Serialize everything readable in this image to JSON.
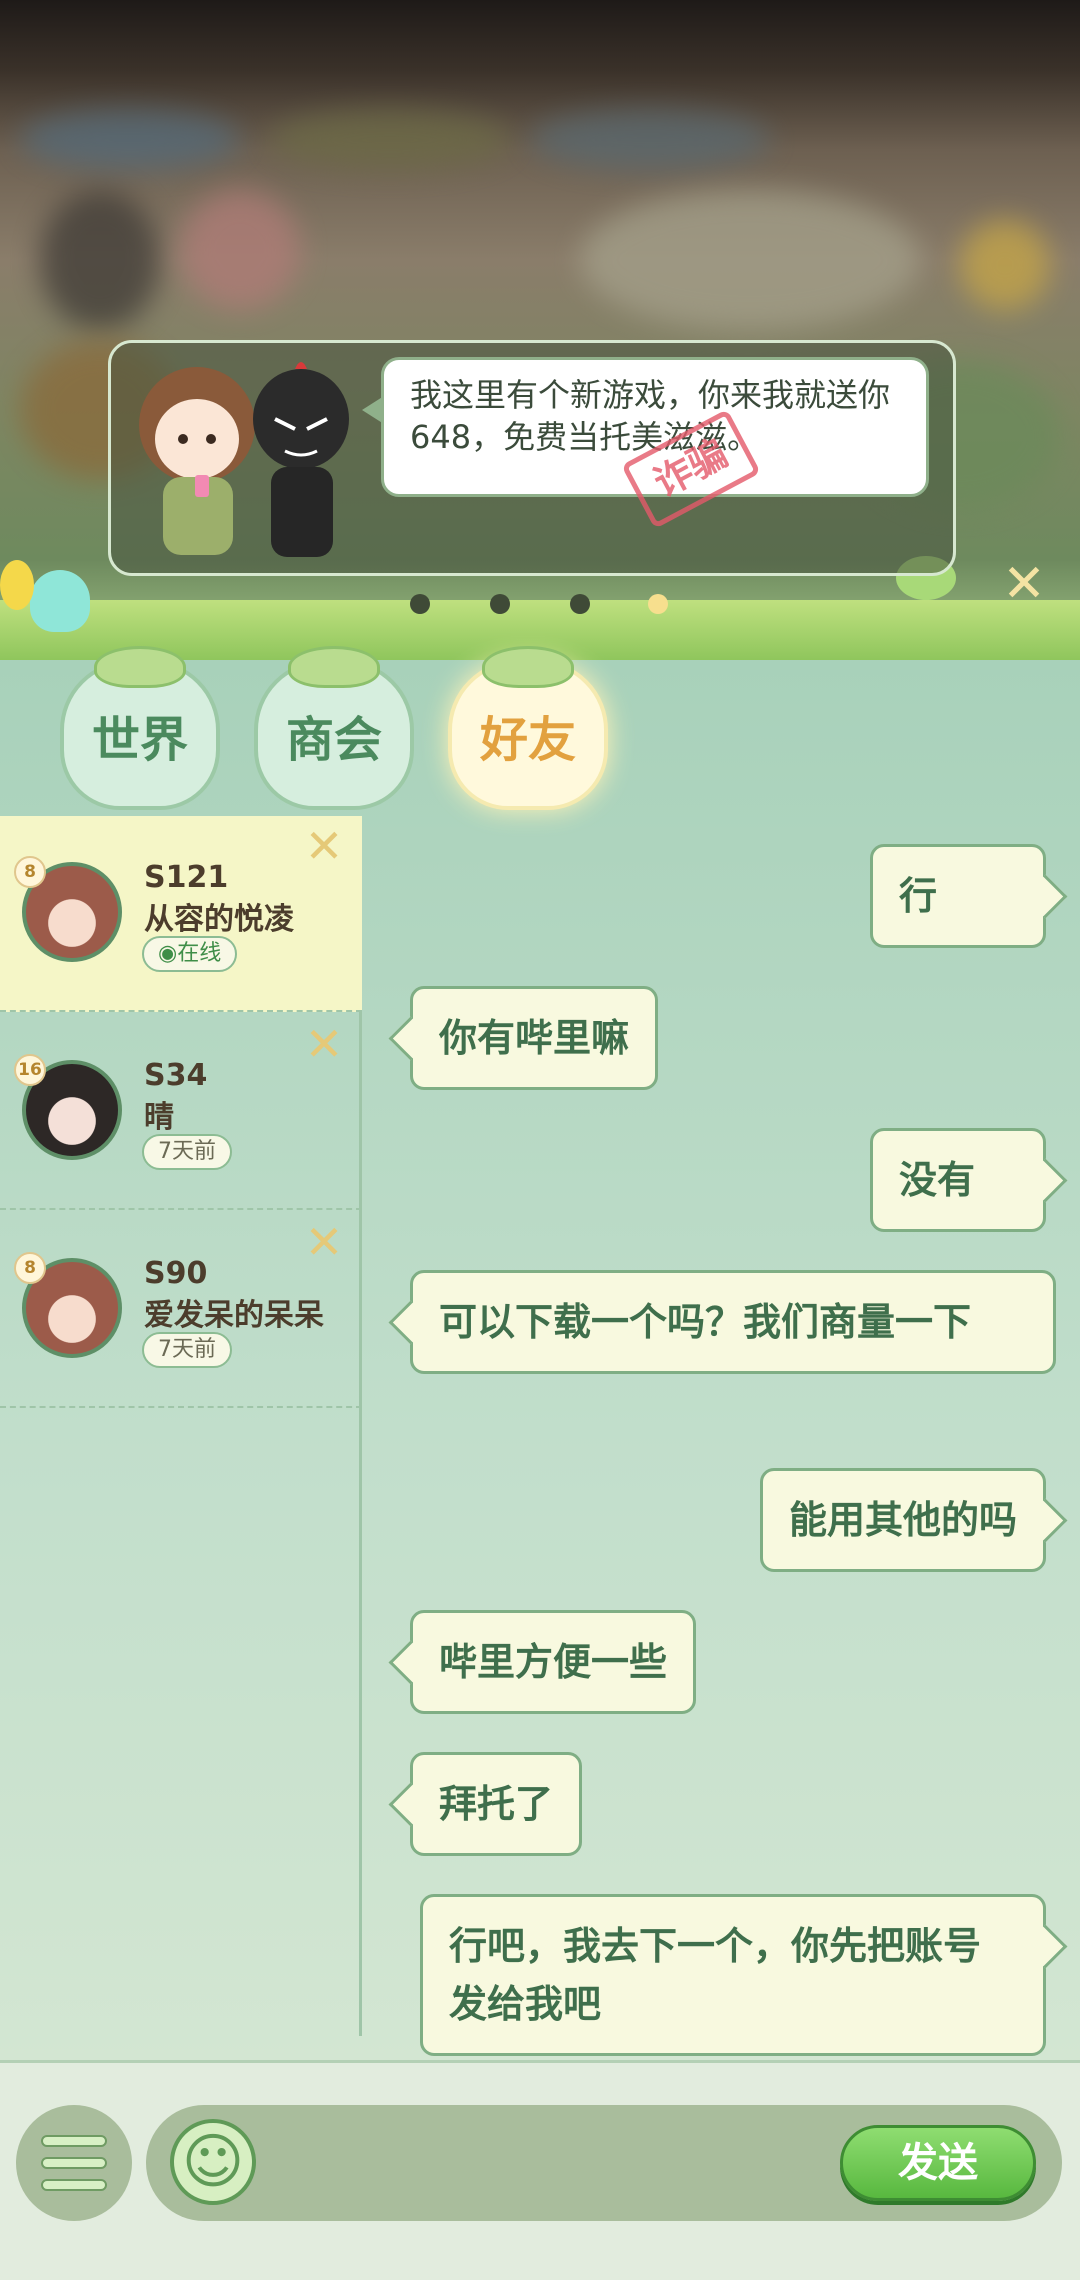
{
  "banner": {
    "message": "我这里有个新游戏，你来我就送你648，免费当托美滋滋。",
    "stamp": "诈骗",
    "close_icon": "close-icon"
  },
  "tabs": [
    {
      "label": "世界",
      "active": false
    },
    {
      "label": "商会",
      "active": false
    },
    {
      "label": "好友",
      "active": true
    }
  ],
  "contacts": [
    {
      "level": "8",
      "server": "S121",
      "name": "从容的悦凌",
      "status": "◉在线",
      "online": true
    },
    {
      "level": "16",
      "server": "S34",
      "name": "晴",
      "status": "7天前",
      "online": false
    },
    {
      "level": "8",
      "server": "S90",
      "name": "爱发呆的呆呆",
      "status": "7天前",
      "online": false
    }
  ],
  "messages": [
    {
      "side": "right",
      "text": "行"
    },
    {
      "side": "left",
      "text": "你有哔里嘛"
    },
    {
      "side": "right",
      "text": "没有"
    },
    {
      "side": "left",
      "text": "可以下载一个吗？我们商量一下"
    },
    {
      "side": "right",
      "text": "能用其他的吗"
    },
    {
      "side": "left",
      "text": "哔里方便一些"
    },
    {
      "side": "left",
      "text": "拜托了"
    },
    {
      "side": "right",
      "text": "行吧，我去下一个，你先把账号发给我吧"
    }
  ],
  "input": {
    "menu_icon": "menu-icon",
    "emoji_icon": "smile-icon",
    "send_label": "发送"
  }
}
